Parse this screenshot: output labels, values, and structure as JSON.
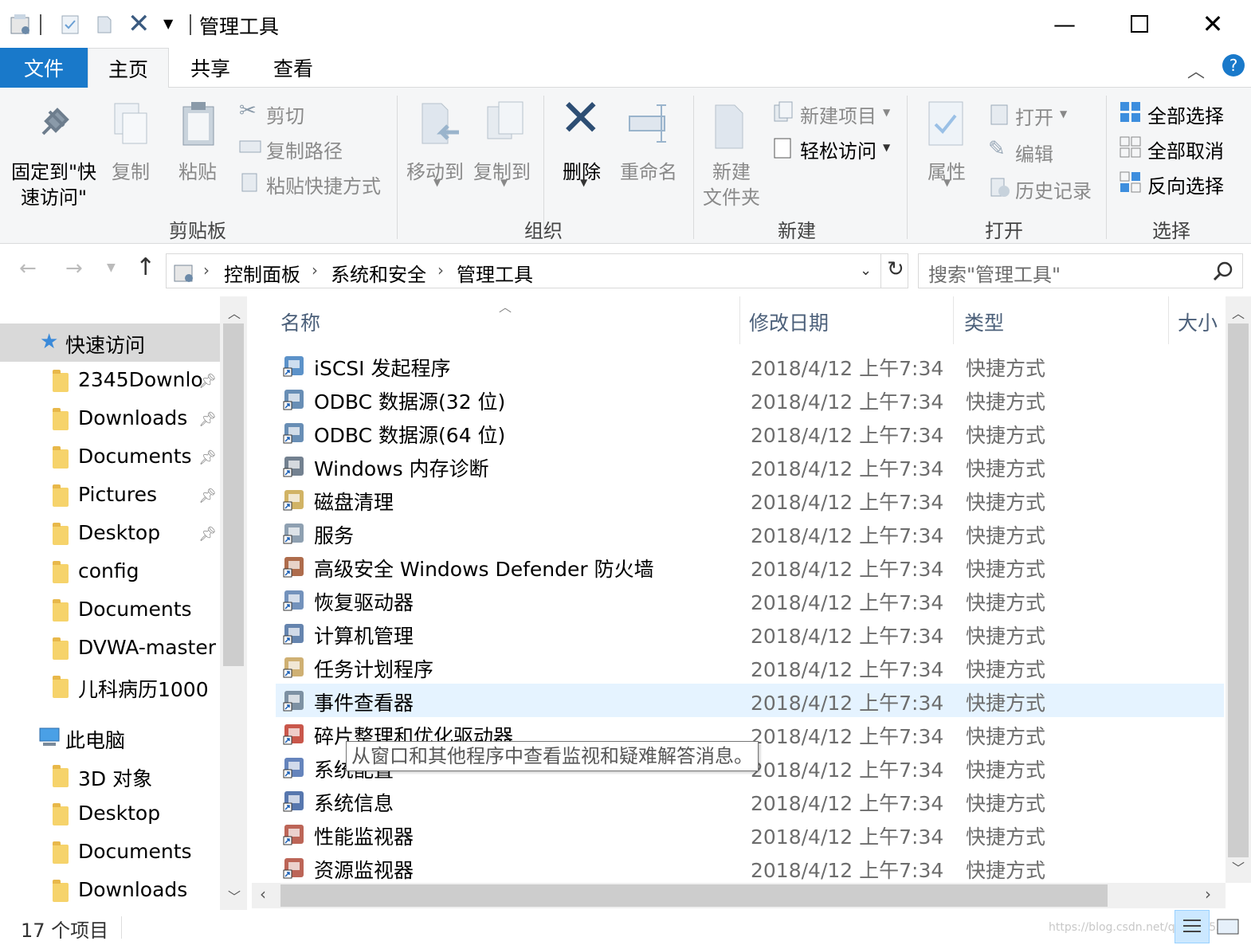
{
  "title": "管理工具",
  "tabs": {
    "file": "文件",
    "home": "主页",
    "share": "共享",
    "view": "查看"
  },
  "ribbon": {
    "clipboard": {
      "pin": "固定到\"快",
      "pin2": "速访问\"",
      "copy": "复制",
      "paste": "粘贴",
      "cut": "剪切",
      "copy_path": "复制路径",
      "paste_shortcut": "粘贴快捷方式",
      "label": "剪贴板"
    },
    "organize": {
      "move_to": "移动到",
      "copy_to": "复制到",
      "delete": "删除",
      "rename": "重命名",
      "label": "组织"
    },
    "new": {
      "new_folder_1": "新建",
      "new_folder_2": "文件夹",
      "new_item": "新建项目",
      "easy_access": "轻松访问",
      "label": "新建"
    },
    "open": {
      "properties": "属性",
      "open": "打开",
      "edit": "编辑",
      "history": "历史记录",
      "label": "打开"
    },
    "select": {
      "select_all": "全部选择",
      "select_none": "全部取消",
      "invert": "反向选择",
      "label": "选择"
    }
  },
  "address": {
    "crumbs": [
      "控制面板",
      "系统和安全",
      "管理工具"
    ],
    "search_placeholder": "搜索\"管理工具\""
  },
  "nav": {
    "quick_access": "快速访问",
    "items": [
      {
        "label": "2345Downlo",
        "pinned": true
      },
      {
        "label": "Downloads",
        "pinned": true
      },
      {
        "label": "Documents",
        "pinned": true
      },
      {
        "label": "Pictures",
        "pinned": true
      },
      {
        "label": "Desktop",
        "pinned": true
      },
      {
        "label": "config",
        "pinned": false
      },
      {
        "label": "Documents",
        "pinned": false
      },
      {
        "label": "DVWA-master",
        "pinned": false
      },
      {
        "label": "儿科病历1000",
        "pinned": false
      }
    ],
    "this_pc": "此电脑",
    "pc_items": [
      "3D 对象",
      "Desktop",
      "Documents",
      "Downloads"
    ]
  },
  "columns": {
    "name": "名称",
    "date": "修改日期",
    "type": "类型",
    "size": "大小"
  },
  "files": [
    {
      "name": "iSCSI 发起程序",
      "date": "2018/4/12 上午7:34",
      "type": "快捷方式"
    },
    {
      "name": "ODBC 数据源(32 位)",
      "date": "2018/4/12 上午7:34",
      "type": "快捷方式"
    },
    {
      "name": "ODBC 数据源(64 位)",
      "date": "2018/4/12 上午7:34",
      "type": "快捷方式"
    },
    {
      "name": "Windows 内存诊断",
      "date": "2018/4/12 上午7:34",
      "type": "快捷方式"
    },
    {
      "name": "磁盘清理",
      "date": "2018/4/12 上午7:34",
      "type": "快捷方式"
    },
    {
      "name": "服务",
      "date": "2018/4/12 上午7:34",
      "type": "快捷方式"
    },
    {
      "name": "高级安全 Windows Defender 防火墙",
      "date": "2018/4/12 上午7:34",
      "type": "快捷方式"
    },
    {
      "name": "恢复驱动器",
      "date": "2018/4/12 上午7:34",
      "type": "快捷方式"
    },
    {
      "name": "计算机管理",
      "date": "2018/4/12 上午7:34",
      "type": "快捷方式"
    },
    {
      "name": "任务计划程序",
      "date": "2018/4/12 上午7:34",
      "type": "快捷方式"
    },
    {
      "name": "事件查看器",
      "date": "2018/4/12 上午7:34",
      "type": "快捷方式"
    },
    {
      "name": "碎片整理和优化驱动器",
      "date": "2018/4/12 上午7:34",
      "type": "快捷方式"
    },
    {
      "name": "系统配置",
      "date": "2018/4/12 上午7:34",
      "type": "快捷方式"
    },
    {
      "name": "系统信息",
      "date": "2018/4/12 上午7:34",
      "type": "快捷方式"
    },
    {
      "name": "性能监视器",
      "date": "2018/4/12 上午7:34",
      "type": "快捷方式"
    },
    {
      "name": "资源监视器",
      "date": "2018/4/12 上午7:34",
      "type": "快捷方式"
    }
  ],
  "selected_index": 10,
  "tooltip": "从窗口和其他程序中查看监视和疑难解答消息。",
  "status": {
    "count": "17 个项目"
  },
  "watermark": "https://blog.csdn.net/qq_45655",
  "colors": {
    "accent": "#1979ca",
    "selection": "#e5f3ff",
    "ribbon_bg": "#f5f6f7"
  }
}
